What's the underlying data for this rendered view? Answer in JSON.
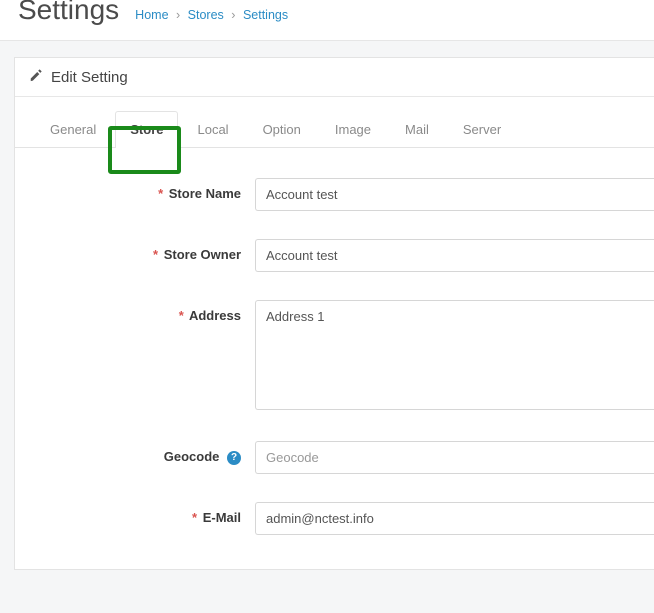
{
  "page": {
    "title": "Settings"
  },
  "breadcrumb": {
    "home": "Home",
    "stores": "Stores",
    "settings": "Settings"
  },
  "panel": {
    "heading": "Edit Setting"
  },
  "tabs": {
    "general": "General",
    "store": "Store",
    "local": "Local",
    "option": "Option",
    "image": "Image",
    "mail": "Mail",
    "server": "Server"
  },
  "fields": {
    "store_name": {
      "label": "Store Name",
      "value": "Account test"
    },
    "store_owner": {
      "label": "Store Owner",
      "value": "Account test"
    },
    "address": {
      "label": "Address",
      "value": "Address 1"
    },
    "geocode": {
      "label": "Geocode",
      "placeholder": "Geocode",
      "value": ""
    },
    "email": {
      "label": "E-Mail",
      "value": "admin@nctest.info"
    }
  },
  "icons": {
    "help": "?"
  }
}
